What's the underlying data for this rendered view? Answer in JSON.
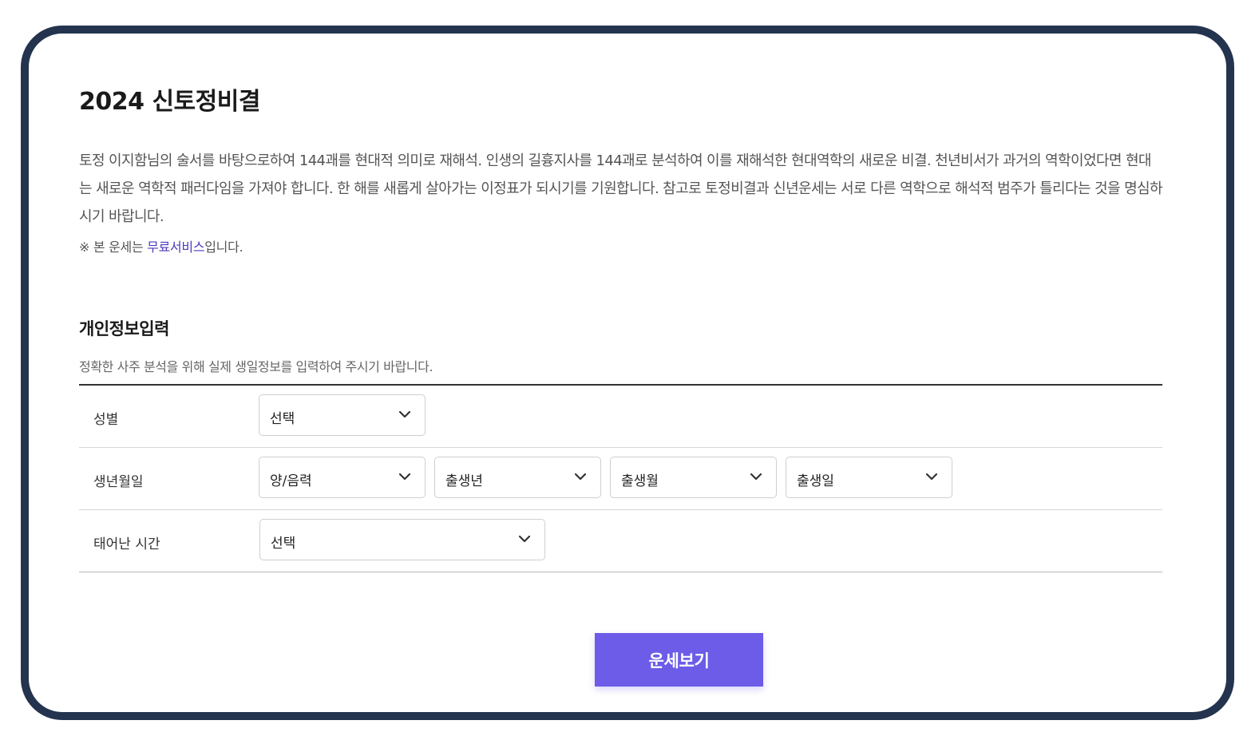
{
  "page": {
    "title": "2024 신토정비결",
    "description": "토정 이지함님의 술서를 바탕으로하여 144괘를 현대적 의미로 재해석. 인생의 길흉지사를 144괘로 분석하여 이를 재해석한 현대역학의 새로운 비결. 천년비서가 과거의 역학이었다면 현대는 새로운 역학적 패러다임을 가져야 합니다. 한 해를 새롭게 살아가는 이정표가 되시기를 기원합니다. 참고로 토정비결과 신년운세는 서로 다른 역학으로 해석적 범주가 틀리다는 것을 명심하시기 바랍니다.",
    "notice": {
      "prefix": "※ 본 운세는 ",
      "link": "무료서비스",
      "suffix": "입니다."
    }
  },
  "form": {
    "title": "개인정보입력",
    "subtitle": "정확한 사주 분석을 위해 실제 생일정보를 입력하여 주시기 바랍니다.",
    "gender": {
      "label": "성별",
      "value": "선택"
    },
    "birth": {
      "label": "생년월일",
      "calendar": "양/음력",
      "year": "출생년",
      "month": "출생월",
      "day": "출생일"
    },
    "time": {
      "label": "태어난 시간",
      "value": "선택"
    },
    "submit_label": "운세보기"
  },
  "colors": {
    "frame": "#24344f",
    "accent": "#6c5ce7",
    "link": "#4b3bbd"
  }
}
